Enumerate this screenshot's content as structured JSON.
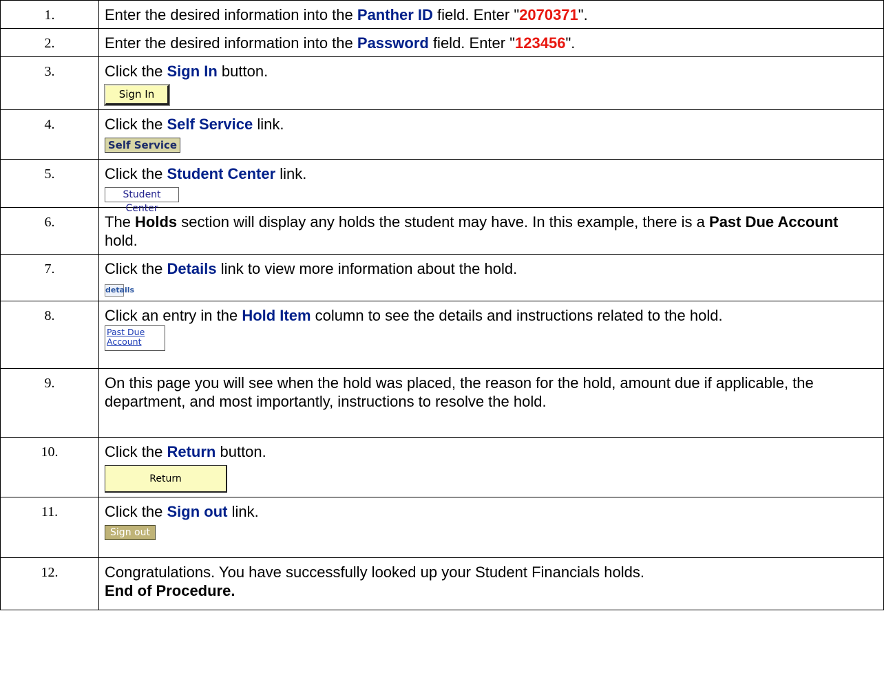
{
  "steps": [
    {
      "num": "1.",
      "t1": "Enter the desired information into the ",
      "ui": "Panther ID",
      "t2": " field. Enter \"",
      "val": "2070371",
      "t3": "\"."
    },
    {
      "num": "2.",
      "t1": "Enter the desired information into the ",
      "ui": "Password",
      "t2": " field. Enter \"",
      "val": "123456",
      "t3": "\"."
    },
    {
      "num": "3.",
      "t1": "Click the ",
      "ui": "Sign In",
      "t2": " button.",
      "shot": "Sign In"
    },
    {
      "num": "4.",
      "t1": "Click the ",
      "ui": "Self Service",
      "t2": " link.",
      "shot": "Self Service"
    },
    {
      "num": "5.",
      "t1": "Click the ",
      "ui": "Student Center",
      "t2": " link.",
      "shot": "Student Center"
    },
    {
      "num": "6.",
      "t1": "The ",
      "b1": "Holds",
      "t2": " section will display any holds the student may have. In this example, there is a ",
      "b2": "Past Due Account",
      "t3": " hold."
    },
    {
      "num": "7.",
      "t1": "Click the ",
      "ui": "Details",
      "t2": " link to view more information about the hold.",
      "shot": "details"
    },
    {
      "num": "8.",
      "t1": "Click an entry in the ",
      "ui": "Hold Item",
      "t2": " column to see the details and instructions related to the hold.",
      "shot_line1": "Past Due",
      "shot_line2": "Account"
    },
    {
      "num": "9.",
      "text": "On this page you will see when the hold was placed, the reason for the hold, amount due if applicable, the department, and most importantly, instructions to resolve the hold."
    },
    {
      "num": "10.",
      "t1": "Click the ",
      "ui": "Return",
      "t2": " button.",
      "shot": "Return"
    },
    {
      "num": "11.",
      "t1": "Click the ",
      "ui": "Sign out",
      "t2": " link.",
      "shot": "Sign out"
    },
    {
      "num": "12.",
      "text": "Congratulations. You have successfully looked up your Student Financials holds.",
      "end": "End of Procedure."
    }
  ],
  "colors": {
    "ui_text": "#00208a",
    "value_text": "#e8170f",
    "button_yellow": "#fbfbb8"
  }
}
